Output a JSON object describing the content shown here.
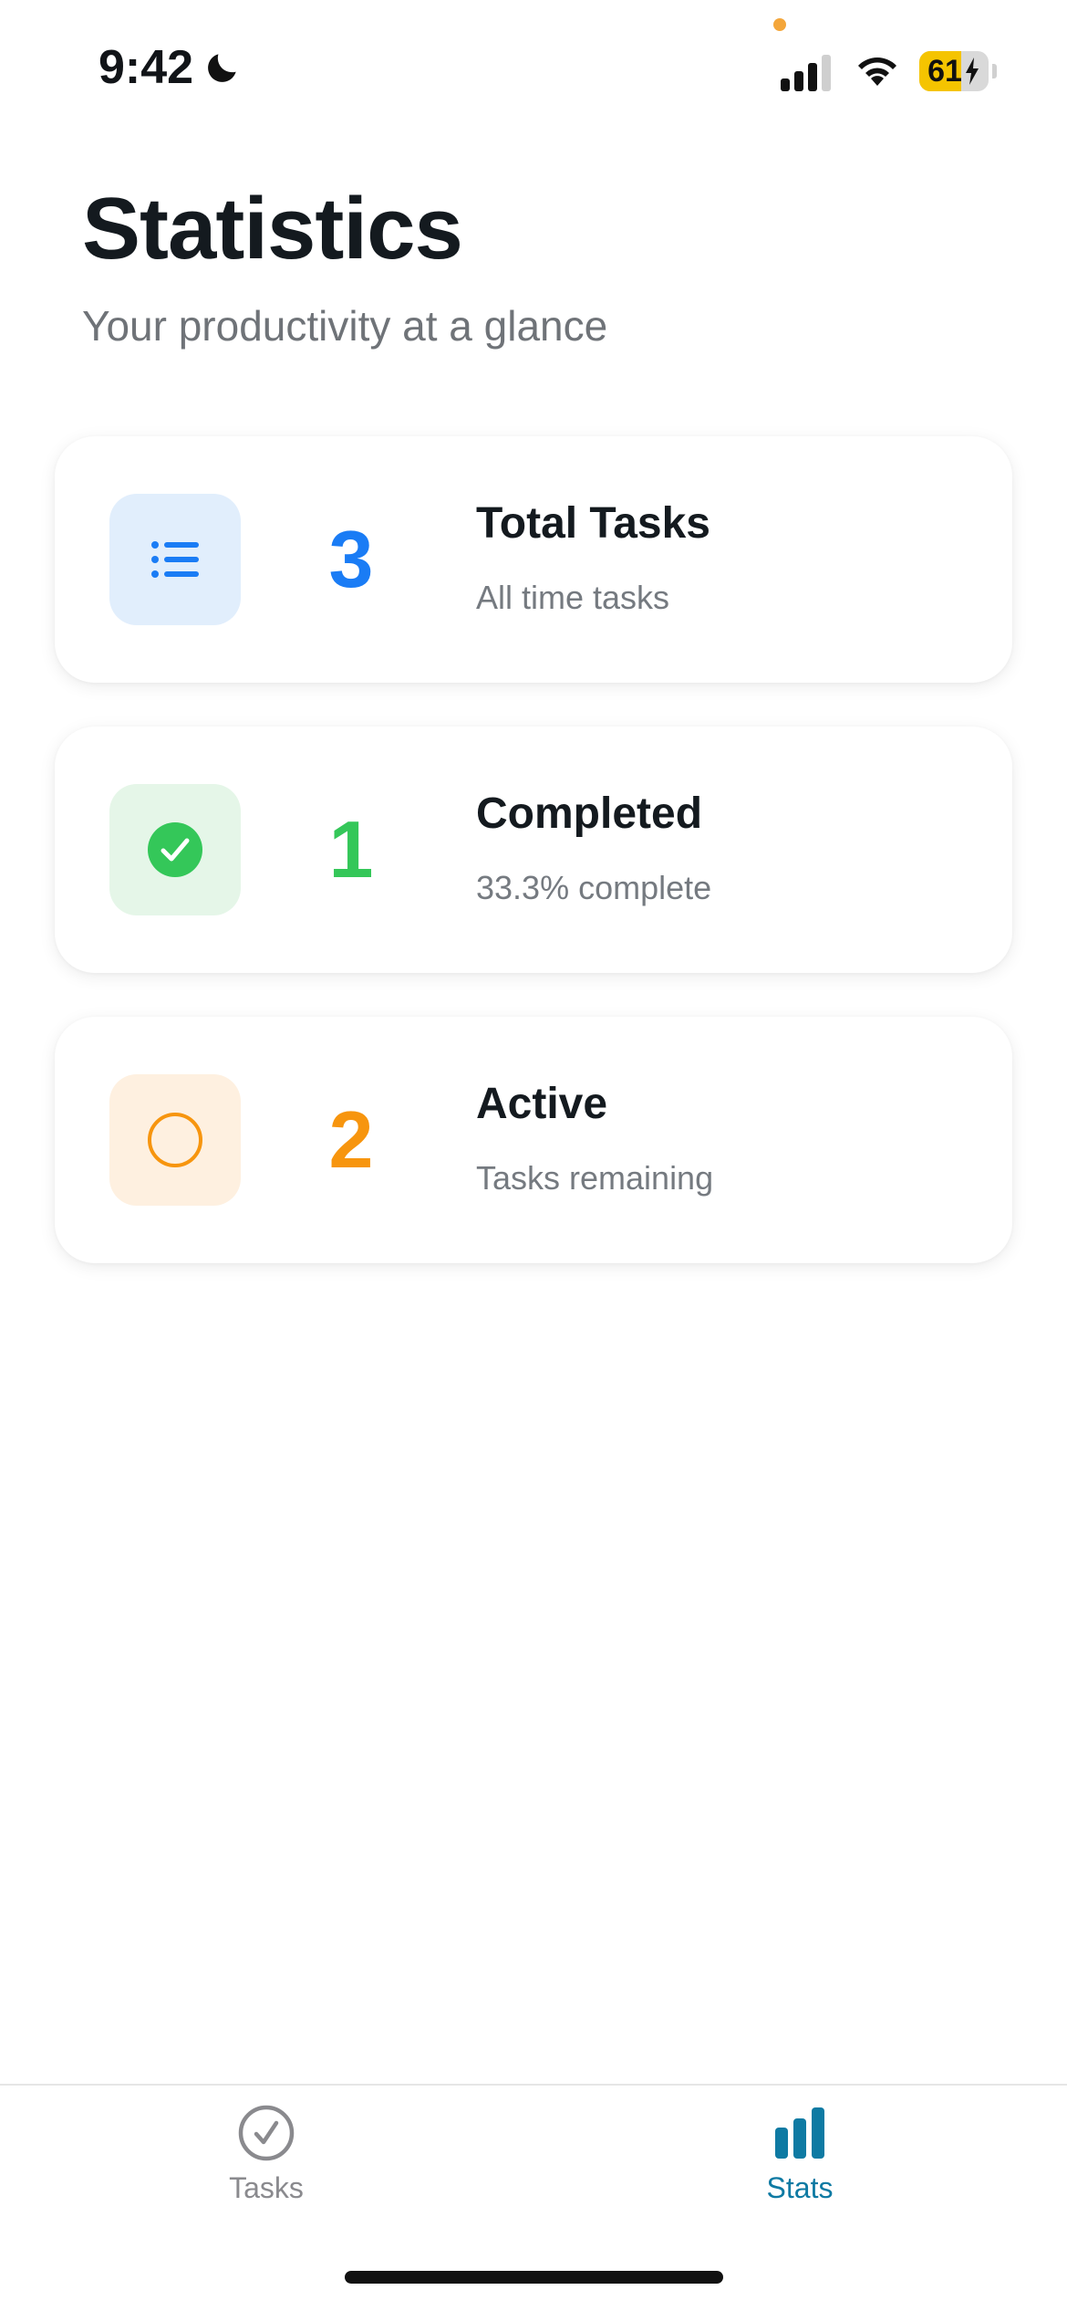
{
  "status_bar": {
    "time": "9:42",
    "battery_level": "61",
    "battery_fraction": 0.61,
    "icons": [
      "moon-icon",
      "cellular-signal-icon",
      "wifi-icon",
      "battery-charging-icon"
    ]
  },
  "header": {
    "title": "Statistics",
    "subtitle": "Your productivity at a glance"
  },
  "cards": [
    {
      "value": "3",
      "title": "Total Tasks",
      "subtitle": "All time tasks",
      "icon": "list-icon",
      "color": "#1a7cf5",
      "tint": "#e1eefc"
    },
    {
      "value": "1",
      "title": "Completed",
      "subtitle": "33.3% complete",
      "icon": "check-circle-icon",
      "color": "#34c759",
      "tint": "#e5f6e8"
    },
    {
      "value": "2",
      "title": "Active",
      "subtitle": "Tasks remaining",
      "icon": "circle-icon",
      "color": "#f7950e",
      "tint": "#fef0e0"
    }
  ],
  "tab_bar": {
    "tabs": [
      {
        "label": "Tasks",
        "icon": "checkmark-circle-icon",
        "active": false
      },
      {
        "label": "Stats",
        "icon": "bar-chart-icon",
        "active": true
      }
    ],
    "active_color": "#0e7aa3",
    "inactive_color": "#8a8a8e"
  }
}
